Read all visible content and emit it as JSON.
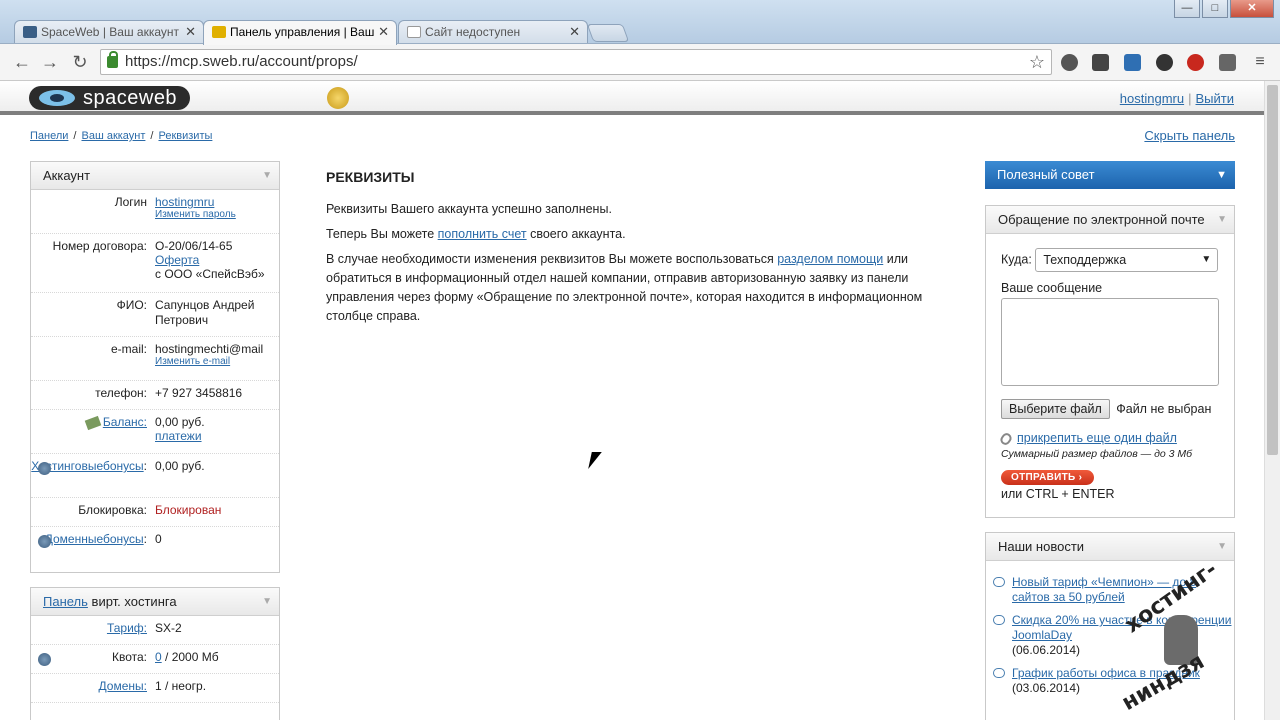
{
  "browser": {
    "tabs": [
      {
        "title": "SpaceWeb | Ваш аккаунт",
        "active": false
      },
      {
        "title": "Панель управления | Ваш",
        "active": true
      },
      {
        "title": "Сайт недоступен",
        "active": false
      }
    ],
    "url": "https://mcp.sweb.ru/account/props/",
    "window_buttons": [
      "—",
      "□",
      "✕"
    ]
  },
  "header": {
    "logo_text": "spaceweb",
    "user_link": "hostingmru",
    "logout": "Выйти"
  },
  "breadcrumb": {
    "items": [
      "Панели",
      "Ваш аккаунт",
      "Реквизиты"
    ],
    "separator": "/",
    "hide_panel": "Скрыть панель"
  },
  "account": {
    "title": "Аккаунт",
    "login_label": "Логин",
    "login_value": "hostingmru",
    "change_password": "Изменить пароль",
    "contract_label": "Номер договора:",
    "contract_value": "О-20/06/14-65",
    "contract_offer": "Оферта",
    "contract_company": "с ООО «СпейсВэб»",
    "fio_label": "ФИО:",
    "fio_value": "Сапунцов Андрей Петрович",
    "email_label": "e-mail:",
    "email_value": "hostingmechti@mail",
    "change_email": "Изменить e-mail",
    "phone_label": "телефон:",
    "phone_value": "+7 927 3458816",
    "balance_label": "Баланс:",
    "balance_value": "0,00 руб.",
    "payments": "платежи",
    "hosting_bonus_label_1": "Хостинговые",
    "hosting_bonus_label_2": "бонусы",
    "hosting_bonus_value": "0,00 руб.",
    "block_label": "Блокировка:",
    "block_value": "Блокирован",
    "domain_bonus_label_1": "Доменные",
    "domain_bonus_label_2": "бонусы",
    "domain_bonus_value": "0"
  },
  "hosting_panel": {
    "title_link": "Панель",
    "title_rest": "вирт. хостинга",
    "tariff_label": "Тариф:",
    "tariff_value": "SX-2",
    "quota_label": "Квота:",
    "quota_used": "0",
    "quota_total": "/ 2000 Мб",
    "domains_label": "Домены:",
    "domains_value": "1 / неогр."
  },
  "main": {
    "title": "РЕКВИЗИТЫ",
    "p1": "Реквизиты Вашего аккаунта успешно заполнены.",
    "p2_before": "Теперь Вы можете ",
    "p2_link": "пополнить счет",
    "p2_after": " своего аккаунта.",
    "p3_before": "В случае необходимости изменения реквизитов Вы можете воспользоваться ",
    "p3_link": "разделом помощи",
    "p3_after": " или обратиться в информационный отдел нашей компании, отправив авторизованную заявку из панели управления через форму «Обращение по электронной почте», которая находится в информационном столбце справа."
  },
  "tip": {
    "title": "Полезный совет"
  },
  "email_form": {
    "title": "Обращение по электронной почте",
    "to_label": "Куда:",
    "to_value": "Техподдержка",
    "message_label": "Ваше сообщение",
    "choose_file": "Выберите файл",
    "no_file": "Файл не выбран",
    "attach_more": "прикрепить еще один файл",
    "size_note": "Суммарный размер файлов — до 3 Мб",
    "send": "ОТПРАВИТЬ",
    "shortcut": "или CTRL + ENTER"
  },
  "news": {
    "title": "Наши новости",
    "items": [
      {
        "text": "Новый тариф «Чемпион» — до 8 сайтов за 50 рублей",
        "date": ""
      },
      {
        "text": "Скидка 20% на участие в конференции JoomlaDay",
        "date": "(06.06.2014)"
      },
      {
        "text": "График работы офиса в праздник",
        "date": "(03.06.2014)"
      }
    ]
  },
  "watermark": {
    "top": "хостинг-",
    "bottom": "ниндзя"
  }
}
